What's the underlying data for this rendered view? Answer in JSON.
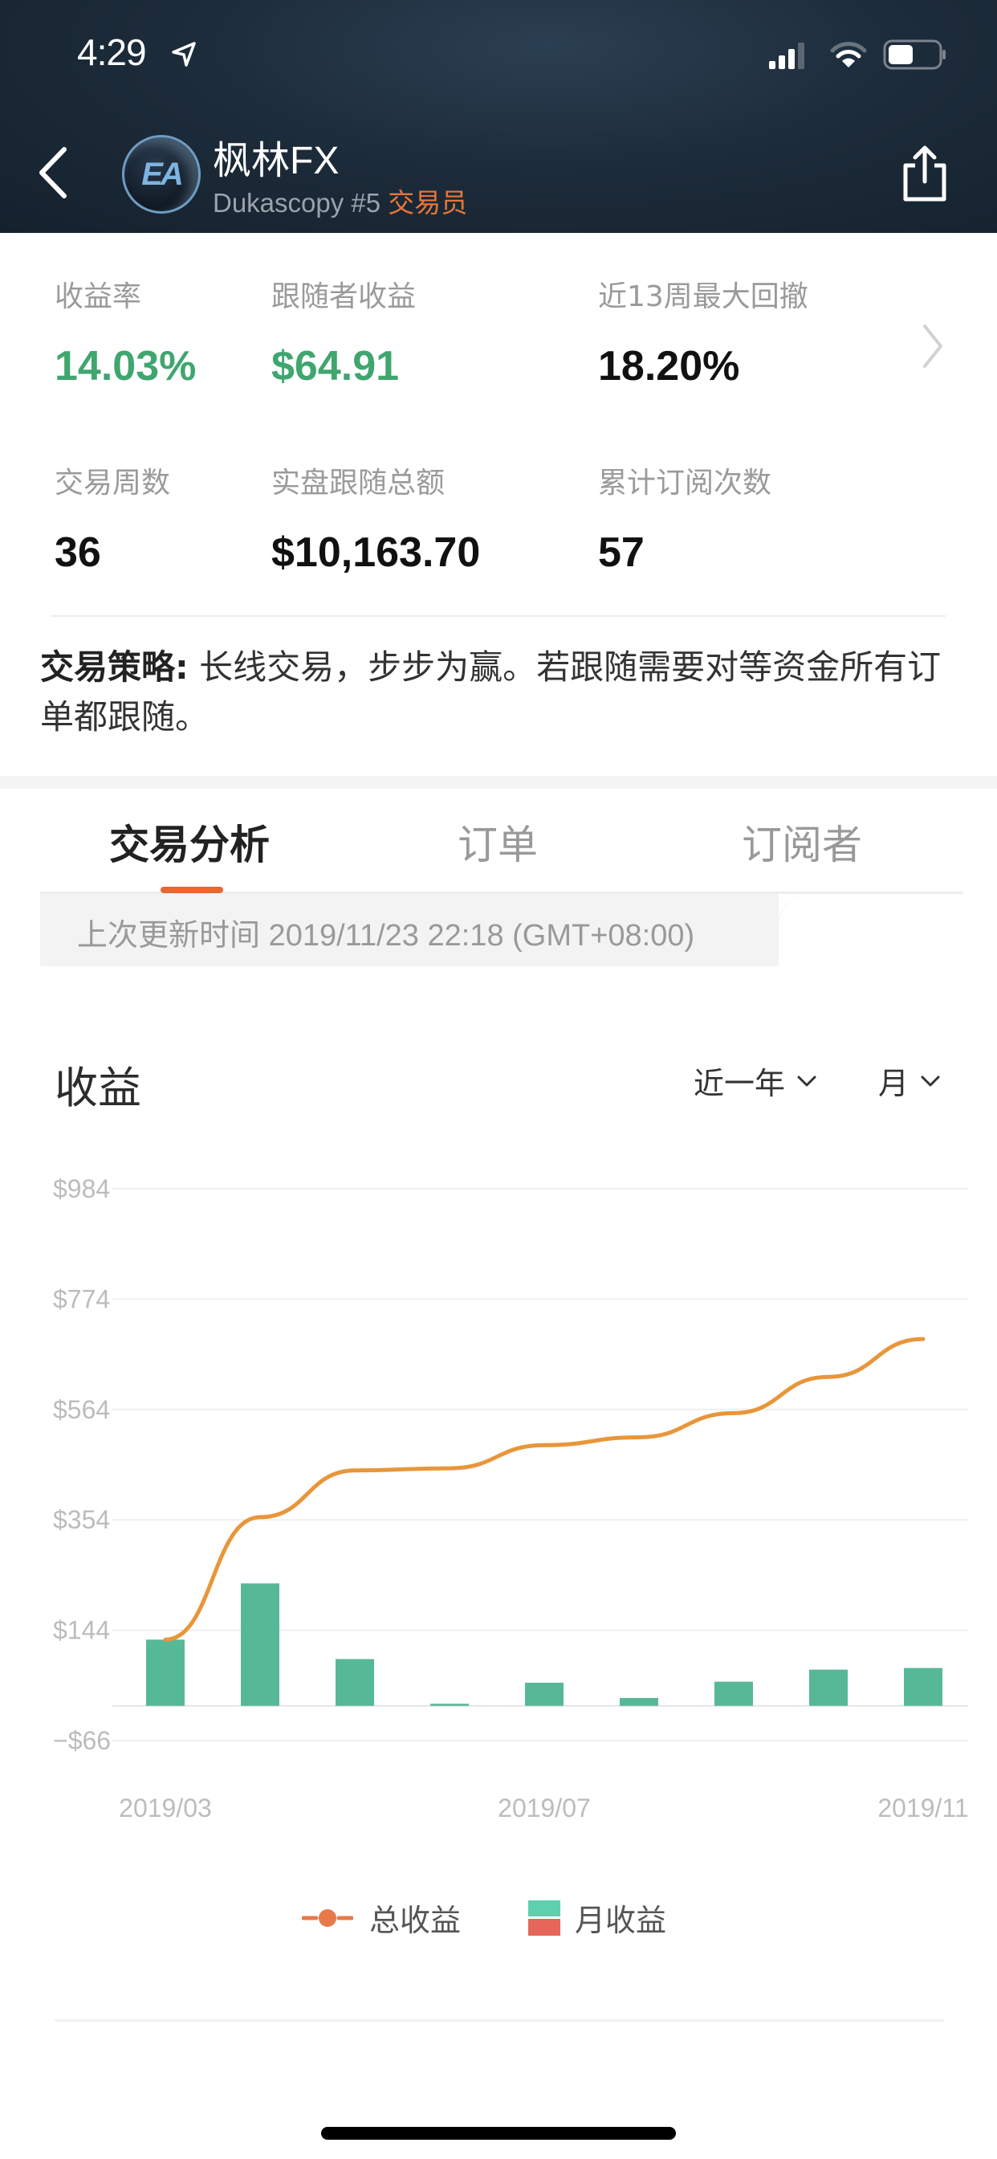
{
  "status_bar": {
    "time": "4:29",
    "icons": [
      "location-arrow-icon",
      "signal-icon",
      "wifi-icon",
      "battery-icon"
    ]
  },
  "header": {
    "back_icon": "chevron-left-icon",
    "avatar_text": "EA",
    "trader_name": "枫林FX",
    "broker_rank": "Dukascopy #5",
    "role": "交易员",
    "share_icon": "share-icon",
    "role_color": "#e8763a"
  },
  "stats": [
    {
      "label": "收益率",
      "value": "14.03%",
      "color": "green"
    },
    {
      "label": "跟随者收益",
      "value": "$64.91",
      "color": "green"
    },
    {
      "label": "近13周最大回撤",
      "value": "18.20%",
      "color": "black"
    },
    {
      "label": "交易周数",
      "value": "36",
      "color": "black"
    },
    {
      "label": "实盘跟随总额",
      "value": "$10,163.70",
      "color": "black"
    },
    {
      "label": "累计订阅次数",
      "value": "57",
      "color": "black"
    }
  ],
  "strategy": {
    "label": "交易策略:",
    "text": " 长线交易，步步为赢。若跟随需要对等资金所有订单都跟随。"
  },
  "tabs": [
    {
      "label": "交易分析",
      "active": true
    },
    {
      "label": "订单",
      "active": false
    },
    {
      "label": "订阅者",
      "active": false
    }
  ],
  "update_info": "上次更新时间 2019/11/23 22:18 (GMT+08:00)",
  "chart_section": {
    "title": "收益",
    "period_dropdown": "近一年",
    "granularity_dropdown": "月"
  },
  "colors": {
    "accent": "#e8672d",
    "green_value": "#3fa66f",
    "bar": "#57b897",
    "line": "#e8963a",
    "legend_bar_positive": "#5fd0ad",
    "legend_bar_negative": "#e5675a",
    "legend_line": "#e87a4a"
  },
  "chart_data": {
    "type": "bar+line",
    "title": "收益",
    "xlabel": "",
    "ylabel": "",
    "y_ticks": [
      984,
      774,
      564,
      354,
      144,
      -66
    ],
    "y_tick_labels": [
      "$984",
      "$774",
      "$564",
      "$354",
      "$144",
      "−$66"
    ],
    "ylim": [
      -66,
      984
    ],
    "grid": true,
    "x_tick_labels": [
      "2019/03",
      "2019/07",
      "2019/11"
    ],
    "categories": [
      "2019/03",
      "2019/04",
      "2019/05",
      "2019/06",
      "2019/07",
      "2019/08",
      "2019/09",
      "2019/10",
      "2019/11"
    ],
    "series": [
      {
        "name": "月收益",
        "type": "bar",
        "values": [
          126,
          233,
          89,
          4,
          44,
          15,
          46,
          69,
          72
        ]
      },
      {
        "name": "总收益",
        "type": "line",
        "values": [
          126,
          359,
          448,
          452,
          496,
          511,
          557,
          626,
          698
        ]
      }
    ],
    "legend": [
      "总收益",
      "月收益"
    ],
    "legend_position": "bottom-center"
  }
}
